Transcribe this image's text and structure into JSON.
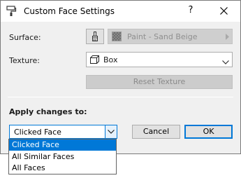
{
  "window": {
    "title": "Custom Face Settings",
    "help_label": "?",
    "icon": "paint-roller-icon"
  },
  "surface": {
    "label": "Surface:",
    "value": "Paint - Sand Beige",
    "picker_icon": "paint-brush-icon"
  },
  "texture": {
    "label": "Texture:",
    "value": "Box",
    "icon": "box-icon"
  },
  "reset_texture_label": "Reset Texture",
  "apply": {
    "label": "Apply changes to:",
    "selected": "Clicked Face",
    "options": [
      "Clicked Face",
      "All Similar Faces",
      "All Faces"
    ],
    "highlighted_index": 0
  },
  "buttons": {
    "cancel": "Cancel",
    "ok": "OK"
  },
  "colors": {
    "dialog_bg": "#f0f0f0",
    "accent": "#0078d7",
    "disabled_text": "#8f8f8f"
  }
}
